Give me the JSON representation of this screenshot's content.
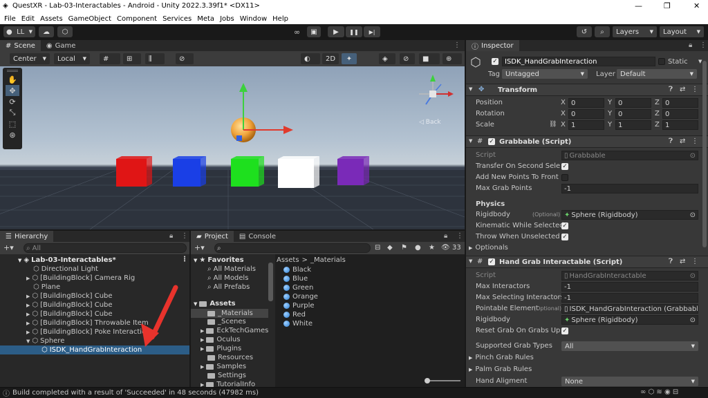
{
  "window": {
    "title": "QuestXR - Lab-03-Interactables - Android - Unity 2022.3.39f1* <DX11>",
    "min": "—",
    "max": "❐",
    "close": "✕"
  },
  "menu": [
    "File",
    "Edit",
    "Assets",
    "GameObject",
    "Component",
    "Services",
    "Meta",
    "Jobs",
    "Window",
    "Help"
  ],
  "toolbar": {
    "account": "LL",
    "layers": "Layers",
    "layout": "Layout",
    "play": "▶",
    "pause": "❚❚",
    "step": "▶|"
  },
  "scene": {
    "tabs": [
      "Scene",
      "Game"
    ],
    "pivot": "Center",
    "space": "Local",
    "mode2d": "2D",
    "back_label": "◁ Back",
    "cubes": [
      {
        "name": "red",
        "color": "#e01515"
      },
      {
        "name": "blue",
        "color": "#1a3fe6"
      },
      {
        "name": "green",
        "color": "#1ee01e"
      },
      {
        "name": "white",
        "color": "#ffffff"
      },
      {
        "name": "purple",
        "color": "#7a2ab8"
      }
    ]
  },
  "hierarchy": {
    "tab": "Hierarchy",
    "search_placeholder": "All",
    "scene_name": "Lab-03-Interactables*",
    "items": [
      "Directional Light",
      "[BuildingBlock] Camera Rig",
      "Plane",
      "[BuildingBlock] Cube",
      "[BuildingBlock] Cube",
      "[BuildingBlock] Cube",
      "[BuildingBlock] Throwable Item",
      "[BuildingBlock] Poke Interaction",
      "Sphere",
      "ISDK_HandGrabInteraction"
    ]
  },
  "project": {
    "tabs": [
      "Project",
      "Console"
    ],
    "count": "33",
    "breadcrumb": [
      "Assets",
      ">",
      "_Materials"
    ],
    "favorites": {
      "title": "Favorites",
      "items": [
        "All Materials",
        "All Models",
        "All Prefabs"
      ]
    },
    "assets": {
      "title": "Assets",
      "items": [
        "_Materials",
        "_Scenes",
        "EckTechGames",
        "Oculus",
        "Plugins",
        "Resources",
        "Samples",
        "Settings",
        "TutorialInfo"
      ]
    },
    "materials": [
      "Black",
      "Blue",
      "Green",
      "Orange",
      "Purple",
      "Red",
      "White"
    ]
  },
  "inspector": {
    "tab": "Inspector",
    "object_name": "ISDK_HandGrabInteraction",
    "static_label": "Static",
    "tag_label": "Tag",
    "tag_value": "Untagged",
    "layer_label": "Layer",
    "layer_value": "Default",
    "transform": {
      "title": "Transform",
      "position_label": "Position",
      "rotation_label": "Rotation",
      "scale_label": "Scale",
      "axes": [
        "X",
        "Y",
        "Z"
      ],
      "position": [
        "0",
        "0",
        "0"
      ],
      "rotation": [
        "0",
        "0",
        "0"
      ],
      "scale": [
        "1",
        "1",
        "1"
      ]
    },
    "grabbable": {
      "title": "Grabbable (Script)",
      "script_label": "Script",
      "script_value": "Grabbable",
      "transfer_label": "Transfer On Second Selec",
      "add_points_label": "Add New Points To Front",
      "max_grab_label": "Max Grab Points",
      "max_grab_value": "-1",
      "physics_label": "Physics",
      "rigidbody_label": "Rigidbody",
      "optional": "(Optional)",
      "rigidbody_value": "Sphere (Rigidbody)",
      "kinematic_label": "Kinematic While Selected",
      "throw_label": "Throw When Unselected",
      "optionals_label": "Optionals"
    },
    "handgrab": {
      "title": "Hand Grab Interactable (Script)",
      "script_label": "Script",
      "script_value": "HandGrabInteractable",
      "max_interactors_label": "Max Interactors",
      "max_interactors_value": "-1",
      "max_selecting_label": "Max Selecting Interactors",
      "max_selecting_value": "-1",
      "pointable_label": "Pointable Element",
      "optional": "(Optional)",
      "pointable_value": "ISDK_HandGrabInteraction (Grabbabl",
      "rigidbody_label": "Rigidbody",
      "rigidbody_value": "Sphere (Rigidbody)",
      "reset_label": "Reset Grab On Grabs Upda",
      "supported_label": "Supported Grab Types",
      "supported_value": "All",
      "pinch_label": "Pinch Grab Rules",
      "palm_label": "Palm Grab Rules",
      "alignment_label": "Hand Aligment",
      "alignment_value": "None"
    }
  },
  "status": {
    "message": "Build completed with a result of 'Succeeded' in 48 seconds (47982 ms)"
  },
  "colors": {
    "accent": "#2c5d87",
    "arrow": "#e8332c"
  }
}
